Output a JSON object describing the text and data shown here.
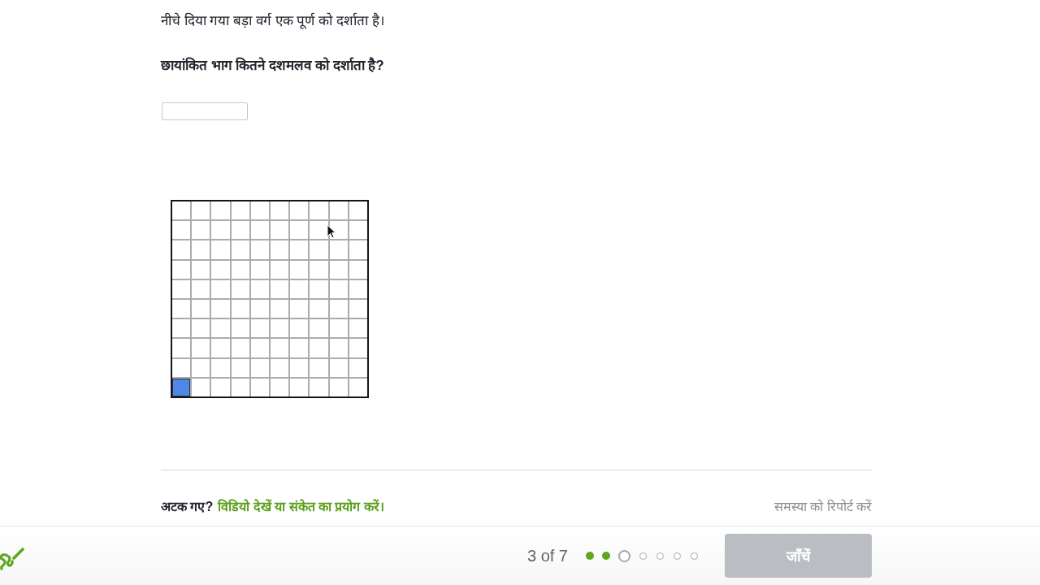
{
  "problem": {
    "instruction": "नीचे दिया गया बड़ा वर्ग एक पूर्ण को दर्शाता है।",
    "question": "छायांकित भाग कितने दशमलव को दर्शाता है?",
    "hundred_grid": {
      "rows": [
        {
          "cells": [
            {
              "shaded": false
            },
            {
              "shaded": false
            },
            {
              "shaded": false
            },
            {
              "shaded": false
            },
            {
              "shaded": false
            },
            {
              "shaded": false
            },
            {
              "shaded": false
            },
            {
              "shaded": false
            },
            {
              "shaded": false
            },
            {
              "shaded": false
            }
          ]
        },
        {
          "cells": [
            {
              "shaded": false
            },
            {
              "shaded": false
            },
            {
              "shaded": false
            },
            {
              "shaded": false
            },
            {
              "shaded": false
            },
            {
              "shaded": false
            },
            {
              "shaded": false
            },
            {
              "shaded": false
            },
            {
              "shaded": false
            },
            {
              "shaded": false
            }
          ]
        },
        {
          "cells": [
            {
              "shaded": false
            },
            {
              "shaded": false
            },
            {
              "shaded": false
            },
            {
              "shaded": false
            },
            {
              "shaded": false
            },
            {
              "shaded": false
            },
            {
              "shaded": false
            },
            {
              "shaded": false
            },
            {
              "shaded": false
            },
            {
              "shaded": false
            }
          ]
        },
        {
          "cells": [
            {
              "shaded": false
            },
            {
              "shaded": false
            },
            {
              "shaded": false
            },
            {
              "shaded": false
            },
            {
              "shaded": false
            },
            {
              "shaded": false
            },
            {
              "shaded": false
            },
            {
              "shaded": false
            },
            {
              "shaded": false
            },
            {
              "shaded": false
            }
          ]
        },
        {
          "cells": [
            {
              "shaded": false
            },
            {
              "shaded": false
            },
            {
              "shaded": false
            },
            {
              "shaded": false
            },
            {
              "shaded": false
            },
            {
              "shaded": false
            },
            {
              "shaded": false
            },
            {
              "shaded": false
            },
            {
              "shaded": false
            },
            {
              "shaded": false
            }
          ]
        },
        {
          "cells": [
            {
              "shaded": false
            },
            {
              "shaded": false
            },
            {
              "shaded": false
            },
            {
              "shaded": false
            },
            {
              "shaded": false
            },
            {
              "shaded": false
            },
            {
              "shaded": false
            },
            {
              "shaded": false
            },
            {
              "shaded": false
            },
            {
              "shaded": false
            }
          ]
        },
        {
          "cells": [
            {
              "shaded": false
            },
            {
              "shaded": false
            },
            {
              "shaded": false
            },
            {
              "shaded": false
            },
            {
              "shaded": false
            },
            {
              "shaded": false
            },
            {
              "shaded": false
            },
            {
              "shaded": false
            },
            {
              "shaded": false
            },
            {
              "shaded": false
            }
          ]
        },
        {
          "cells": [
            {
              "shaded": false
            },
            {
              "shaded": false
            },
            {
              "shaded": false
            },
            {
              "shaded": false
            },
            {
              "shaded": false
            },
            {
              "shaded": false
            },
            {
              "shaded": false
            },
            {
              "shaded": false
            },
            {
              "shaded": false
            },
            {
              "shaded": false
            }
          ]
        },
        {
          "cells": [
            {
              "shaded": false
            },
            {
              "shaded": false
            },
            {
              "shaded": false
            },
            {
              "shaded": false
            },
            {
              "shaded": false
            },
            {
              "shaded": false
            },
            {
              "shaded": false
            },
            {
              "shaded": false
            },
            {
              "shaded": false
            },
            {
              "shaded": false
            }
          ]
        },
        {
          "cells": [
            {
              "shaded": true
            },
            {
              "shaded": false
            },
            {
              "shaded": false
            },
            {
              "shaded": false
            },
            {
              "shaded": false
            },
            {
              "shaded": false
            },
            {
              "shaded": false
            },
            {
              "shaded": false
            },
            {
              "shaded": false
            },
            {
              "shaded": false
            }
          ]
        }
      ]
    }
  },
  "help": {
    "prompt": "अटक गए?",
    "hint_link": "विडियो देखें या संकेत का प्रयोग करें।",
    "report_link": "समस्या को रिपोर्ट करें"
  },
  "footer": {
    "progress_text": "3 of 7",
    "progress_dots": [
      {
        "completed": true,
        "current": false
      },
      {
        "completed": true,
        "current": false
      },
      {
        "completed": false,
        "current": true
      },
      {
        "completed": false,
        "current": false
      },
      {
        "completed": false,
        "current": false
      },
      {
        "completed": false,
        "current": false
      },
      {
        "completed": false,
        "current": false
      }
    ],
    "check_button": {
      "label": "जाँचें",
      "disabled": true
    }
  }
}
